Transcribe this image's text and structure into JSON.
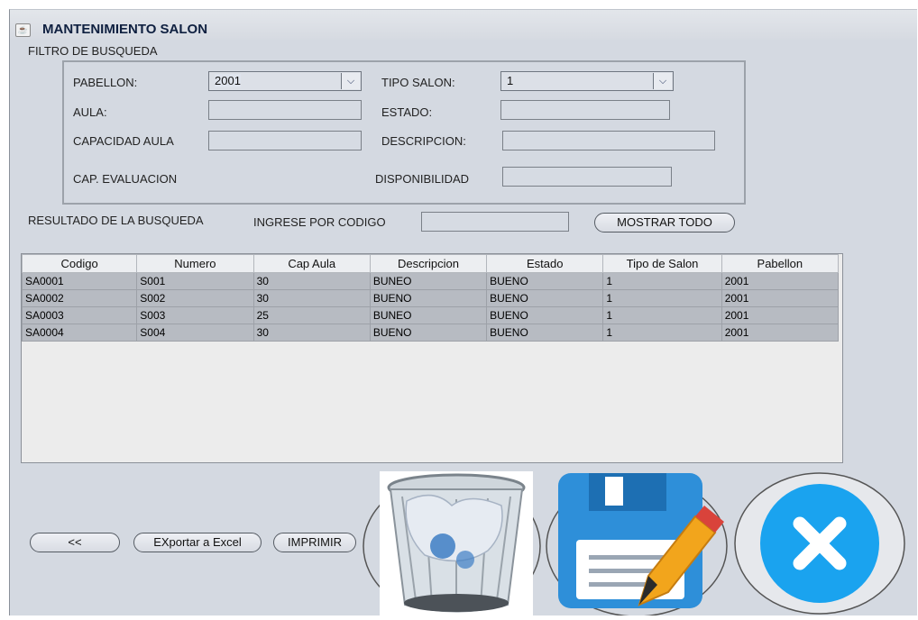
{
  "window": {
    "title": "MANTENIMIENTO SALON"
  },
  "filter": {
    "section_label": "FILTRO DE BUSQUEDA",
    "pabellon_label": "PABELLON:",
    "pabellon_value": "2001",
    "tipo_salon_label": "TIPO SALON:",
    "tipo_salon_value": "1",
    "aula_label": "AULA:",
    "estado_label": "ESTADO:",
    "capacidad_label": "CAPACIDAD AULA",
    "descripcion_label": "DESCRIPCION:",
    "cap_eval_label": "CAP. EVALUACION",
    "disponibilidad_label": "DISPONIBILIDAD"
  },
  "results": {
    "section_label": "RESULTADO DE LA BUSQUEDA",
    "search_label": "INGRESE POR CODIGO",
    "search_value": "",
    "show_all_label": "MOSTRAR TODO"
  },
  "table": {
    "columns": [
      "Codigo",
      "Numero",
      "Cap Aula",
      "Descripcion",
      "Estado",
      "Tipo de Salon",
      "Pabellon"
    ],
    "rows": [
      [
        "SA0001",
        "S001",
        "30",
        "BUNEO",
        "BUENO",
        "1",
        "2001"
      ],
      [
        "SA0002",
        "S002",
        "30",
        "BUENO",
        "BUENO",
        "1",
        "2001"
      ],
      [
        "SA0003",
        "S003",
        "25",
        "BUNEO",
        "BUENO",
        "1",
        "2001"
      ],
      [
        "SA0004",
        "S004",
        "30",
        "BUENO",
        "BUENO",
        "1",
        "2001"
      ]
    ]
  },
  "actions": {
    "back_label": "<<",
    "export_label": "EXportar a Excel",
    "print_label": "IMPRIMIR"
  },
  "icons": {
    "java": "java-cup-icon",
    "delete": "trash-can-icon",
    "save": "save-edit-icon",
    "close": "close-x-icon"
  },
  "colors": {
    "background": "#d4d9e1",
    "save_blue": "#2e8fd9",
    "close_blue": "#1aa3ef",
    "pencil_orange": "#f2a51c"
  }
}
